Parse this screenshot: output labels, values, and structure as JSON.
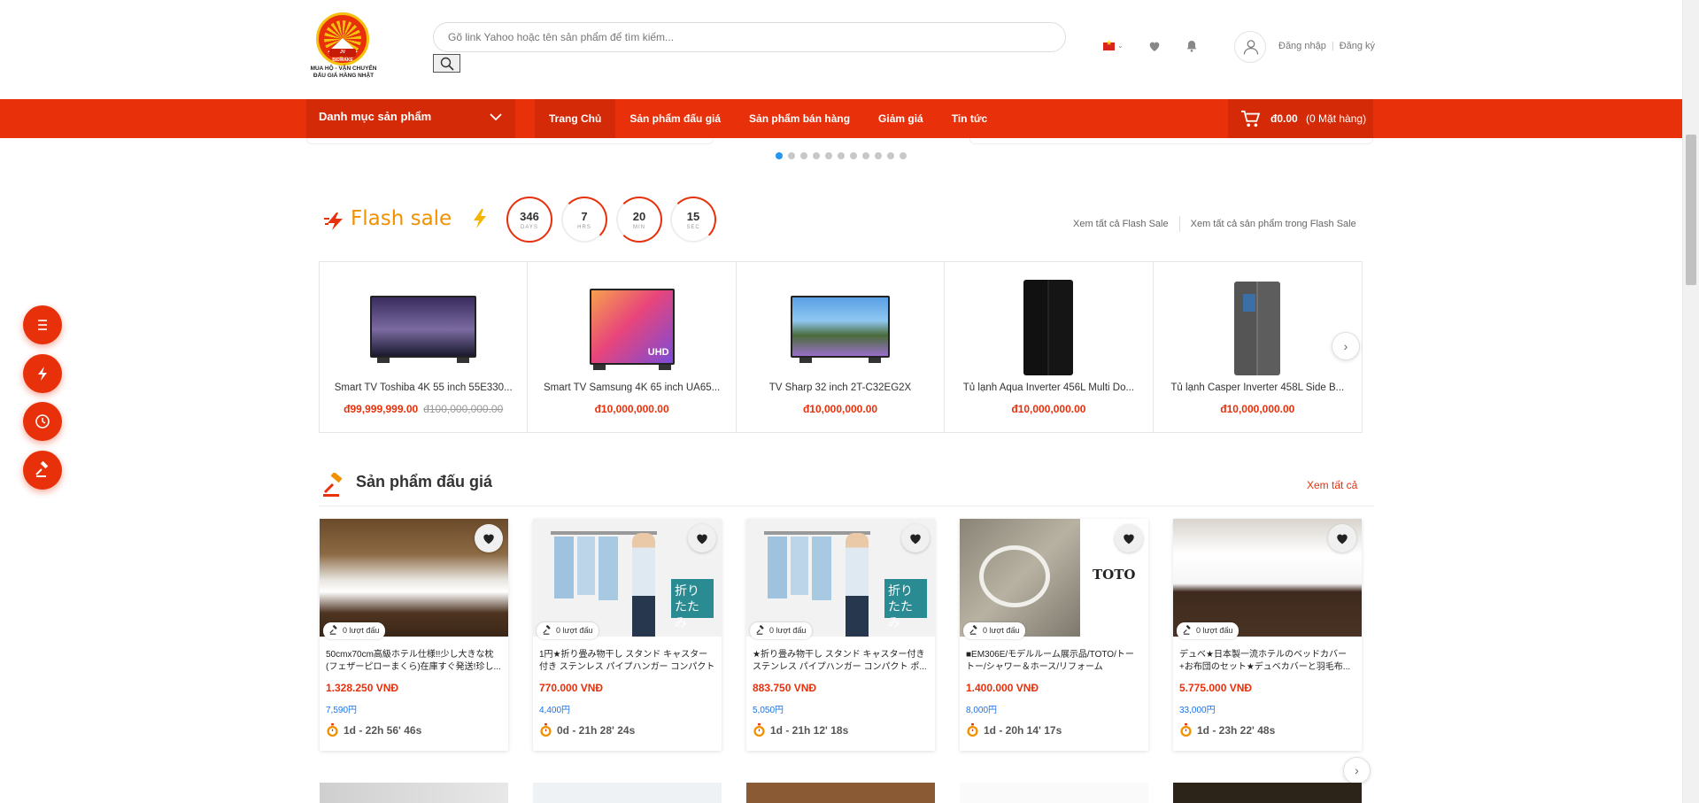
{
  "header": {
    "logo_line1": "MUA HỘ - VẬN CHUYỂN",
    "logo_line2": "ĐẤU GIÁ HÀNG NHẬT",
    "logo_plate": "JV BIDWAKE",
    "search_placeholder": "Gõ link Yahoo hoặc tên sản phẩm để tìm kiếm...",
    "login": "Đăng nhập",
    "register": "Đăng ký",
    "language_icon": "vietnam-flag-icon"
  },
  "nav": {
    "category_menu": "Danh mục sản phẩm",
    "items": [
      "Trang Chủ",
      "Sản phẩm đấu giá",
      "Sản phẩm bán hàng",
      "Giảm giá",
      "Tin tức"
    ],
    "active_index": 0,
    "cart_amount": "đ0.00",
    "cart_count": "(0 Mặt hàng)"
  },
  "carousel": {
    "dot_count": 11,
    "active_dot": 0
  },
  "flash_sale": {
    "title": "Flash sale",
    "timer": [
      {
        "value": "346",
        "unit": "DAYS"
      },
      {
        "value": "7",
        "unit": "HRS"
      },
      {
        "value": "20",
        "unit": "MIN"
      },
      {
        "value": "15",
        "unit": "SEC"
      }
    ],
    "link_all": "Xem tất cả Flash Sale",
    "link_products": "Xem tất cả sản phẩm trong Flash Sale",
    "products": [
      {
        "name": "Smart TV Toshiba 4K 55 inch 55E330...",
        "price": "đ99,999,999.00",
        "old_price": "đ100,000,000.00"
      },
      {
        "name": "Smart TV Samsung 4K 65 inch UA65...",
        "price": "đ10,000,000.00",
        "old_price": ""
      },
      {
        "name": "TV Sharp 32 inch 2T-C32EG2X",
        "price": "đ10,000,000.00",
        "old_price": ""
      },
      {
        "name": "Tủ lạnh Aqua Inverter 456L Multi Do...",
        "price": "đ10,000,000.00",
        "old_price": ""
      },
      {
        "name": "Tủ lạnh Casper Inverter 458L Side B...",
        "price": "đ10,000,000.00",
        "old_price": ""
      }
    ],
    "tv_badge": "UHD"
  },
  "auction": {
    "title": "Sản phẩm đấu giá",
    "view_all": "Xem tất cả",
    "items": [
      {
        "bids": "0 lượt đấu",
        "name": "50cmx70cm高級ホテル仕様!!少し大きな枕(フェザーピローまくら)在庫すぐ発送!珍し...",
        "vnd": "1.328.250 VNĐ",
        "yen": "7,590円",
        "time": "1d - 22h 56' 46s"
      },
      {
        "bids": "0 lượt đấu",
        "name": "1円★折り畳み物干し スタンド キャスター付き ステンレス パイプハンガー コンパクト ...",
        "vnd": "770.000 VNĐ",
        "yen": "4,400円",
        "time": "0d - 21h 28' 24s"
      },
      {
        "bids": "0 lượt đấu",
        "name": "★折り畳み物干し スタンド キャスター付き ステンレス パイプハンガー コンパクト ポ...",
        "vnd": "883.750 VNĐ",
        "yen": "5,050円",
        "time": "1d - 21h 12' 18s"
      },
      {
        "bids": "0 lượt đấu",
        "name": "■EM306E/モデルルーム展示品/TOTO/トートー/シャワー＆ホース/リフォーム",
        "vnd": "1.400.000 VNĐ",
        "yen": "8,000円",
        "time": "1d - 20h 14' 17s"
      },
      {
        "bids": "0 lượt đấu",
        "name": "デュベ★日本製一流ホテルのベッドカバー+お布団のセット★デュベカバーと羽毛布...",
        "vnd": "5.775.000 VNĐ",
        "yen": "33,000円",
        "time": "1d - 23h 22' 48s"
      }
    ],
    "overlay_fold": "折り",
    "overlay_tatami": "たたみ",
    "toto_brand": "TOTO"
  },
  "colors": {
    "brand": "#e8300b",
    "flash": "#f29100",
    "yen": "#1a73e8"
  }
}
